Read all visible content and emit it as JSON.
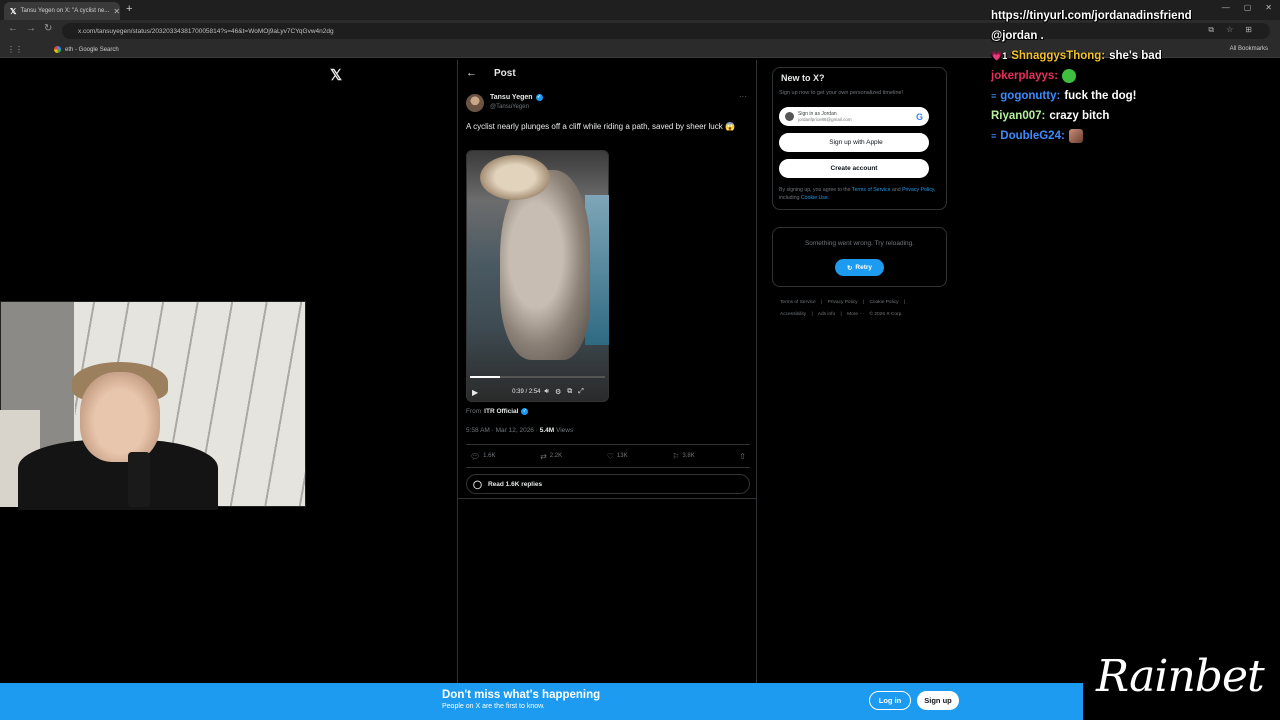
{
  "browser": {
    "tab_title": "Tansu Yegen on X: \"A cyclist ne...",
    "url": "x.com/tansuyegen/status/2032033438170005814?s=46&t=WoMOj9aLyv7CYqGvw4n2dg",
    "bookmark": "eth - Google Search",
    "all_bookmarks": "All Bookmarks"
  },
  "post_header": {
    "title": "Post"
  },
  "tweet": {
    "author_name": "Tansu Yegen",
    "author_handle": "@TansuYegen",
    "text": "A cyclist nearly plunges off a cliff while riding a path, saved by sheer luck 😱",
    "video_time": "0:39 / 2:54",
    "video_progress": 0.22,
    "from_label": "From",
    "from_source": "ITR Official",
    "timestamp": "5:58 AM · Mar 12, 2026 ·",
    "views_count": "5.4M",
    "views_label": "Views",
    "replies": "1.6K",
    "reposts": "2.2K",
    "likes": "13K",
    "bookmarks": "3.8K",
    "read_replies": "Read 1.6K replies"
  },
  "sidebar": {
    "new_title": "New to X?",
    "new_sub": "Sign up now to get your own personalized timeline!",
    "google_line1": "Sign in as Jordan",
    "google_line2": "jordanfprice88@gmail.com",
    "apple_label": "Sign up with Apple",
    "create_label": "Create account",
    "terms_pre": "By signing up, you agree to the",
    "terms_tos": "Terms of Service",
    "terms_and": "and",
    "terms_privacy": "Privacy Policy",
    "terms_mid": ", including",
    "terms_cookie": "Cookie Use.",
    "error_text": "Something went wrong. Try reloading.",
    "retry_label": "Retry",
    "footer": [
      "Terms of Service",
      "|",
      "Privacy Policy",
      "|",
      "Cookie Policy",
      "|",
      "Accessibility",
      "|",
      "Ads info",
      "|",
      "More ···",
      "© 2026 X Corp."
    ]
  },
  "chat": [
    {
      "user": "https://tinyurl.com/jordanadinsfriend",
      "message": "",
      "color": "#ffffff",
      "badge": ""
    },
    {
      "user": "@jordan .",
      "message": "",
      "color": "#ffffff",
      "badge": ""
    },
    {
      "user": "ShnaggysThong:",
      "message": "she's bad",
      "color": "#f2c12e",
      "badge": "💗1"
    },
    {
      "user": "jokerplayys:",
      "message": "",
      "color": "#e8305a",
      "badge": ""
    },
    {
      "user": "gogonutty:",
      "message": "fuck the dog!",
      "color": "#3d8bfd",
      "badge": "≡"
    },
    {
      "user": "Riyan007:",
      "message": "crazy bitch",
      "color": "#b6f09c",
      "badge": ""
    },
    {
      "user": "DoubleG24:",
      "message": "",
      "color": "#3d8bfd",
      "badge": "≡"
    }
  ],
  "banner": {
    "title": "Don't miss what's happening",
    "subtitle": "People on X are the first to know.",
    "login": "Log in",
    "signup": "Sign up"
  },
  "sponsor": {
    "logo_text": "Rainbet"
  },
  "colors": {
    "x_blue": "#1d9bf0",
    "background": "#000000",
    "border": "#2f3336"
  }
}
